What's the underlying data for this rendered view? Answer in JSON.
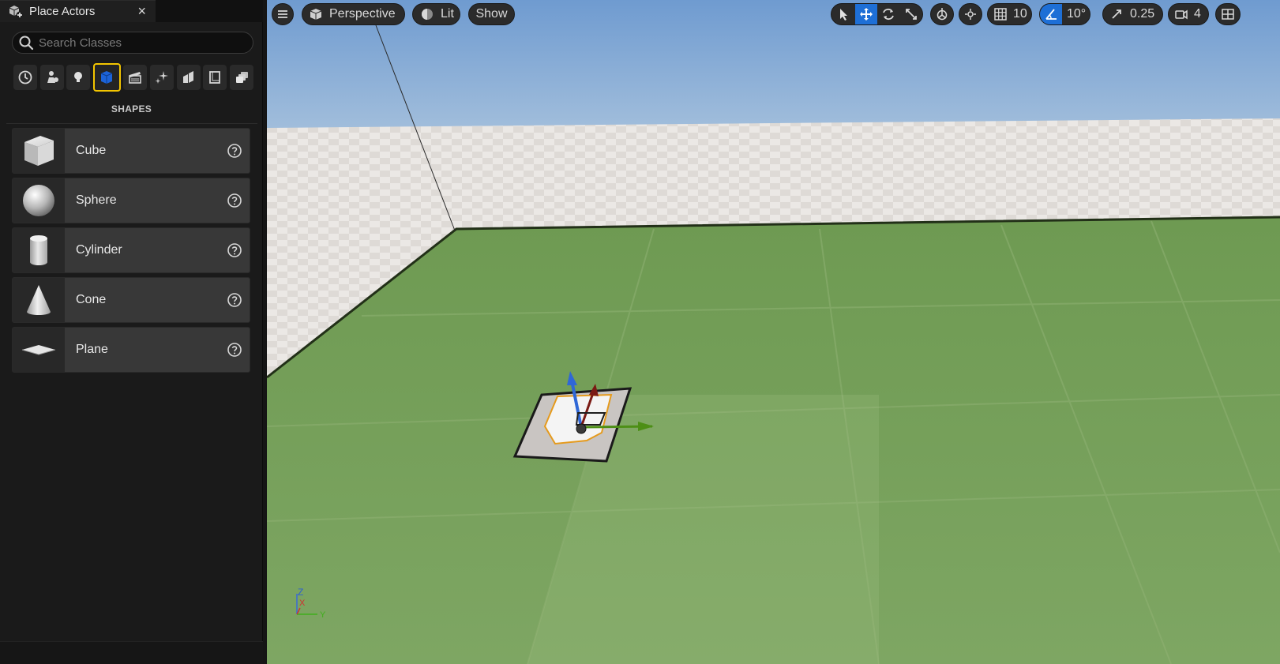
{
  "panel": {
    "tab_title": "Place Actors",
    "tab_close": "×",
    "search_placeholder": "Search Classes",
    "categories": [
      {
        "name": "recent",
        "icon": "clock-icon"
      },
      {
        "name": "basic",
        "icon": "basic-actors-icon"
      },
      {
        "name": "lights",
        "icon": "light-bulb-icon"
      },
      {
        "name": "shapes",
        "icon": "blue-cube-icon",
        "active": true
      },
      {
        "name": "cinematic",
        "icon": "clapperboard-icon"
      },
      {
        "name": "visual-effects",
        "icon": "sparkles-icon"
      },
      {
        "name": "geometry",
        "icon": "geometry-icon"
      },
      {
        "name": "volumes",
        "icon": "volume-icon"
      },
      {
        "name": "all-classes",
        "icon": "stacked-boxes-icon"
      }
    ],
    "section_title": "SHAPES",
    "items": [
      {
        "label": "Cube",
        "icon": "cube-icon"
      },
      {
        "label": "Sphere",
        "icon": "sphere-icon"
      },
      {
        "label": "Cylinder",
        "icon": "cylinder-icon"
      },
      {
        "label": "Cone",
        "icon": "cone-icon"
      },
      {
        "label": "Plane",
        "icon": "plane-icon"
      }
    ]
  },
  "viewport": {
    "menu_icon": "hamburger-icon",
    "view_mode": "Perspective",
    "lighting": "Lit",
    "show": "Show",
    "grid_snap": "10",
    "rotation_snap": "10°",
    "scale_snap": "0.25",
    "camera_speed": "4",
    "axis_z": "Z",
    "axis_x": "X",
    "axis_y": "Y"
  },
  "colors": {
    "accent": "#1e6fd6",
    "active_category_border": "#f3c500",
    "sky": "#7fa6d2",
    "floor_green": "#6f9a50",
    "checker_light": "#e9e6e3"
  }
}
